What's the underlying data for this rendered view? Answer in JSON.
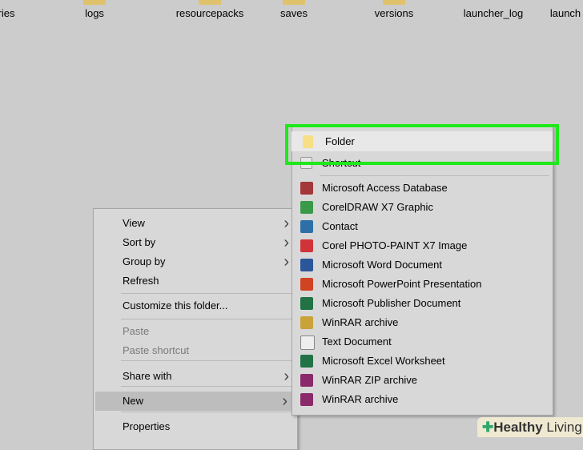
{
  "files": [
    "ries",
    "logs",
    "resourcepacks",
    "saves",
    "versions",
    "launcher_log",
    "launch"
  ],
  "context_menu": {
    "items": [
      {
        "label": "View",
        "submenu": true
      },
      {
        "label": "Sort by",
        "submenu": true
      },
      {
        "label": "Group by",
        "submenu": true
      },
      {
        "label": "Refresh"
      },
      {
        "label": "Customize this folder..."
      },
      {
        "label": "Paste",
        "disabled": true
      },
      {
        "label": "Paste shortcut",
        "disabled": true
      },
      {
        "label": "Share with",
        "submenu": true
      },
      {
        "label": "New",
        "submenu": true,
        "highlighted": true
      },
      {
        "label": "Properties"
      }
    ]
  },
  "new_submenu": {
    "folder": "Folder",
    "shortcut": "Shortcut",
    "items": [
      {
        "label": "Microsoft Access Database",
        "icon": "access-icon",
        "color": "#a4373a"
      },
      {
        "label": "CorelDRAW X7 Graphic",
        "icon": "coreldraw-icon",
        "color": "#3a9a4a"
      },
      {
        "label": "Contact",
        "icon": "contact-icon",
        "color": "#2f6fa8"
      },
      {
        "label": "Corel PHOTO-PAINT X7 Image",
        "icon": "photopaint-icon",
        "color": "#d0343a"
      },
      {
        "label": "Microsoft Word Document",
        "icon": "word-icon",
        "color": "#2b579a"
      },
      {
        "label": "Microsoft PowerPoint Presentation",
        "icon": "powerpoint-icon",
        "color": "#d04423"
      },
      {
        "label": "Microsoft Publisher Document",
        "icon": "publisher-icon",
        "color": "#217346"
      },
      {
        "label": "WinRAR archive",
        "icon": "winrar-icon",
        "color": "#c9a23a"
      },
      {
        "label": "Text Document",
        "icon": "text-document-icon",
        "color": "#eeeeee"
      },
      {
        "label": "Microsoft Excel Worksheet",
        "icon": "excel-icon",
        "color": "#217346"
      },
      {
        "label": "WinRAR ZIP archive",
        "icon": "winrar-zip-icon",
        "color": "#8a2a6a"
      },
      {
        "label": "WinRAR archive",
        "icon": "winrar-icon",
        "color": "#8a2a6a"
      }
    ]
  },
  "watermark": {
    "brand1": "Healthy",
    "brand2": "Living"
  },
  "highlight_color": "#1ee81a"
}
